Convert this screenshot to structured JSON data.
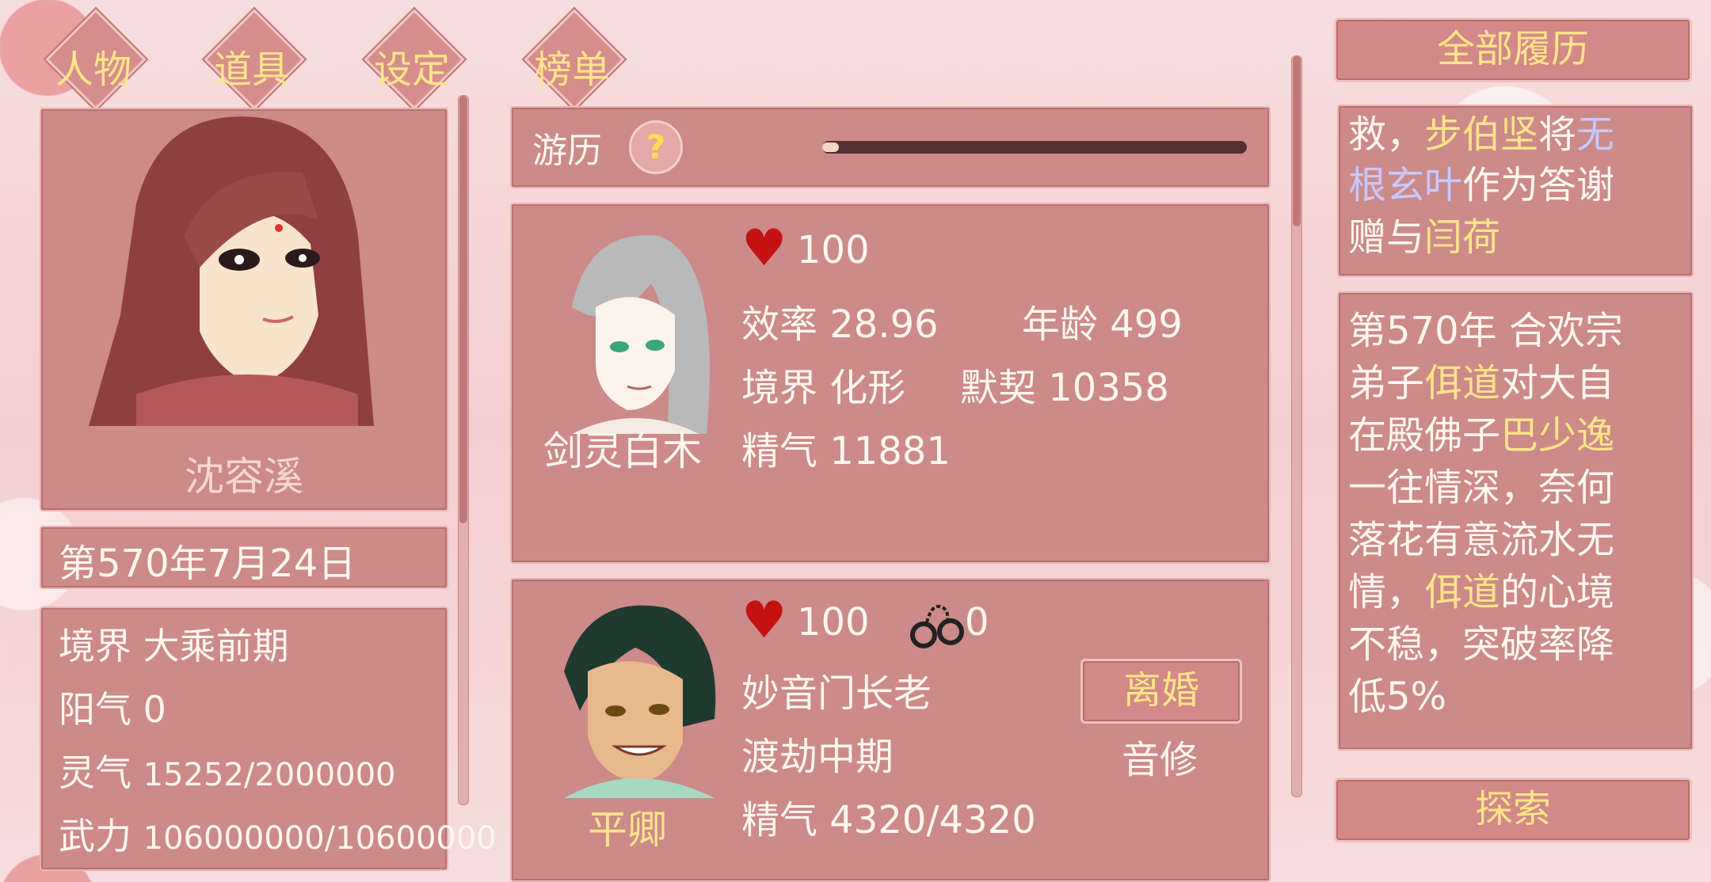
{
  "tabs": [
    "人物",
    "道具",
    "设定",
    "榜单"
  ],
  "player": {
    "name": "沈容溪",
    "date": "第570年7月24日",
    "stats": [
      {
        "label": "境界",
        "value": "大乘前期"
      },
      {
        "label": "阳气",
        "value": "0"
      },
      {
        "label": "灵气",
        "value": "15252/2000000"
      },
      {
        "label": "武力",
        "value": "106000000/10600000"
      }
    ]
  },
  "travel": {
    "label": "游历",
    "help_icon": "question-icon",
    "progress": 0.02
  },
  "partners": [
    {
      "name": "剑灵白木",
      "hearts": "100",
      "efficiency": "效率 28.96",
      "age": "年龄 499",
      "realm": "境界 化形",
      "bond": "默契 10358",
      "essence": "精气 11881"
    },
    {
      "name": "平卿",
      "hearts": "100",
      "cuffs": "0",
      "title": "妙音门长老",
      "realm": "渡劫中期",
      "essence": "精气 4320/4320",
      "divorce": "离婚",
      "profession": "音修"
    }
  ],
  "history": {
    "header": "全部履历",
    "entry1": {
      "parts": [
        {
          "t": "救，",
          "c": "w"
        },
        {
          "t": "步伯坚",
          "c": "g"
        },
        {
          "t": "将",
          "c": "w"
        },
        {
          "t": "无",
          "c": "l"
        }
      ],
      "line2": [
        {
          "t": "根玄叶",
          "c": "l"
        },
        {
          "t": "作为答谢",
          "c": "w"
        }
      ],
      "line3": [
        {
          "t": "赠与",
          "c": "w"
        },
        {
          "t": "闫荷",
          "c": "g"
        }
      ]
    },
    "entry2": [
      [
        {
          "t": "第570年 合欢宗",
          "c": "w"
        }
      ],
      [
        {
          "t": "弟子",
          "c": "w"
        },
        {
          "t": "佴道",
          "c": "g"
        },
        {
          "t": "对大自",
          "c": "w"
        }
      ],
      [
        {
          "t": "在殿佛子",
          "c": "w"
        },
        {
          "t": "巴少逸",
          "c": "g"
        }
      ],
      [
        {
          "t": "一往情深，奈何",
          "c": "w"
        }
      ],
      [
        {
          "t": "落花有意流水无",
          "c": "w"
        }
      ],
      [
        {
          "t": "情，",
          "c": "w"
        },
        {
          "t": "佴道",
          "c": "g"
        },
        {
          "t": "的心境",
          "c": "w"
        }
      ],
      [
        {
          "t": "不稳，突破率降",
          "c": "w"
        }
      ],
      [
        {
          "t": "低5%",
          "c": "w"
        }
      ]
    ],
    "explore": "探索"
  },
  "colors": {
    "panel": "#cc8a89",
    "gold": "#ffe48a",
    "lilac": "#c9c8ff",
    "heart": "#c41212"
  }
}
